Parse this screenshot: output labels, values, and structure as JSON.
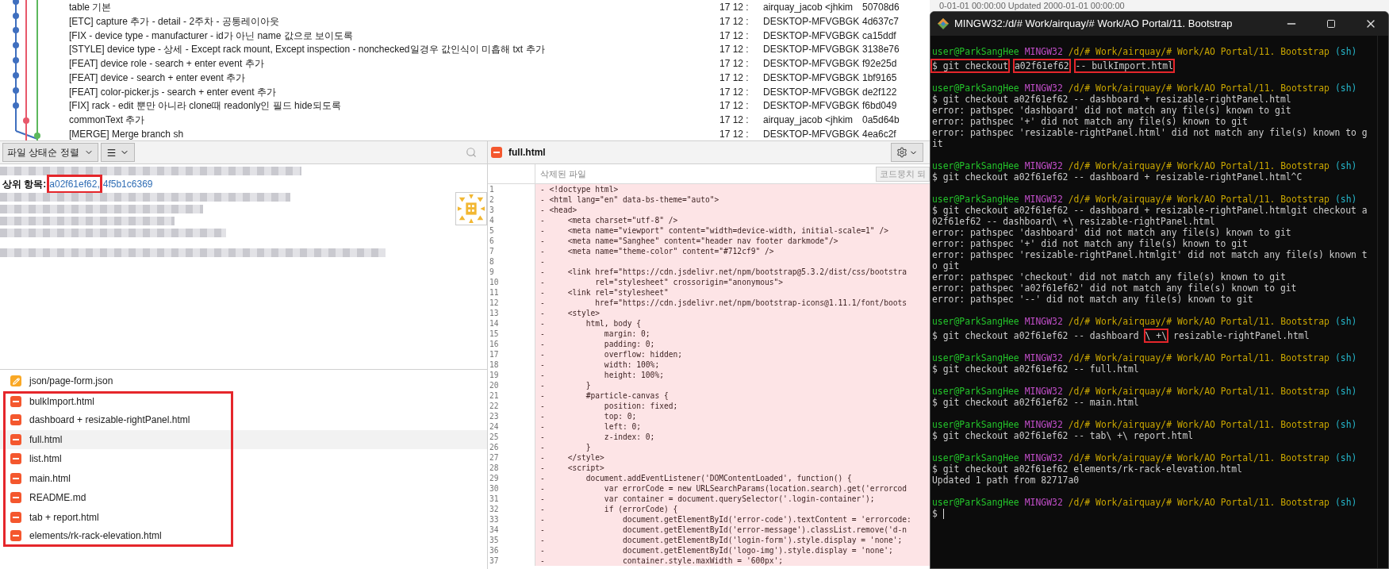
{
  "commits": [
    {
      "message": "table 기본",
      "date": "17 12 :",
      "author": "airquay_jacob <jhkim",
      "hash": "50708d6"
    },
    {
      "message": "[ETC] capture 추가 - detail - 2주차 - 공통레이아웃",
      "date": "17 12 :",
      "author": "DESKTOP-MFVGBGK",
      "hash": "4d637c7"
    },
    {
      "message": "[FIX - device type - manufacturer - id가 아닌 name 값으로 보이도록",
      "date": "17 12 :",
      "author": "DESKTOP-MFVGBGK",
      "hash": "ca15ddf"
    },
    {
      "message": "[STYLE] device type - 상세 - Except rack mount, Except inspection - nonchecked일경우 값인식이 미흡해 txt 추가",
      "date": "17 12 :",
      "author": "DESKTOP-MFVGBGK",
      "hash": "3138e76"
    },
    {
      "message": "[FEAT] device role - search + enter event 추가",
      "date": "17 12 :",
      "author": "DESKTOP-MFVGBGK",
      "hash": "f92e25d"
    },
    {
      "message": "[FEAT] device - search + enter event 추가",
      "date": "17 12 :",
      "author": "DESKTOP-MFVGBGK",
      "hash": "1bf9165"
    },
    {
      "message": "[FEAT] color-picker.js - search + enter event 추가",
      "date": "17 12 :",
      "author": "DESKTOP-MFVGBGK",
      "hash": "de2f122"
    },
    {
      "message": "[FIX] rack - edit 뿐만 아니라 clone때 readonly인 필드 hide되도록",
      "date": "17 12 :",
      "author": "DESKTOP-MFVGBGK",
      "hash": "f6bd049"
    },
    {
      "message": "commonText 추가",
      "date": "17 12 :",
      "author": "airquay_jacob <jhkim",
      "hash": "0a5d64b"
    },
    {
      "message": "[MERGE] Merge branch sh",
      "date": "17 12 :",
      "author": "DESKTOP-MFVGBGK",
      "hash": "4ea6c2f"
    }
  ],
  "toolbar": {
    "sort_label": "파일 상태순 정렬"
  },
  "details": {
    "parents_label": "상위 항목:",
    "parents": [
      {
        "text": "a02f61ef62,",
        "highlighted": true
      },
      {
        "text": "4f5b1c6369",
        "highlighted": false
      }
    ]
  },
  "files": [
    {
      "name": "json/page-form.json",
      "kind": "modified",
      "selected": false,
      "highlighted": false
    },
    {
      "name": "bulkImport.html",
      "kind": "removed",
      "selected": false,
      "highlighted": true
    },
    {
      "name": "dashboard + resizable-rightPanel.html",
      "kind": "removed",
      "selected": false,
      "highlighted": true
    },
    {
      "name": "full.html",
      "kind": "removed",
      "selected": true,
      "highlighted": true
    },
    {
      "name": "list.html",
      "kind": "removed",
      "selected": false,
      "highlighted": true
    },
    {
      "name": "main.html",
      "kind": "removed",
      "selected": false,
      "highlighted": true
    },
    {
      "name": "README.md",
      "kind": "removed",
      "selected": false,
      "highlighted": true
    },
    {
      "name": "tab + report.html",
      "kind": "removed",
      "selected": false,
      "highlighted": true
    },
    {
      "name": "elements/rk-rack-elevation.html",
      "kind": "removed",
      "selected": false,
      "highlighted": true
    }
  ],
  "diff": {
    "file": "full.html",
    "kind": "removed",
    "subtitle": "삭제된 파일",
    "hunk_button": "코드뭉치 되",
    "lines": [
      {
        "number": "1",
        "text": "- <!doctype html>"
      },
      {
        "number": "2",
        "text": "- <html lang=\"en\" data-bs-theme=\"auto\">"
      },
      {
        "number": "3",
        "text": "- <head>"
      },
      {
        "number": "4",
        "text": "-     <meta charset=\"utf-8\" />"
      },
      {
        "number": "5",
        "text": "-     <meta name=\"viewport\" content=\"width=device-width, initial-scale=1\" />"
      },
      {
        "number": "6",
        "text": "-     <meta name=\"Sanghee\" content=\"header nav footer darkmode\"/>"
      },
      {
        "number": "7",
        "text": "-     <meta name=\"theme-color\" content=\"#712cf9\" />"
      },
      {
        "number": "8",
        "text": "-"
      },
      {
        "number": "9",
        "text": "-     <link href=\"https://cdn.jsdelivr.net/npm/bootstrap@5.3.2/dist/css/bootstra"
      },
      {
        "number": "10",
        "text": "-           rel=\"stylesheet\" crossorigin=\"anonymous\">"
      },
      {
        "number": "11",
        "text": "-     <link rel=\"stylesheet\""
      },
      {
        "number": "12",
        "text": "-           href=\"https://cdn.jsdelivr.net/npm/bootstrap-icons@1.11.1/font/boots"
      },
      {
        "number": "13",
        "text": "-     <style>"
      },
      {
        "number": "14",
        "text": "-         html, body {"
      },
      {
        "number": "15",
        "text": "-             margin: 0;"
      },
      {
        "number": "16",
        "text": "-             padding: 0;"
      },
      {
        "number": "17",
        "text": "-             overflow: hidden;"
      },
      {
        "number": "18",
        "text": "-             width: 100%;"
      },
      {
        "number": "19",
        "text": "-             height: 100%;"
      },
      {
        "number": "20",
        "text": "-         }"
      },
      {
        "number": "21",
        "text": "-         #particle-canvas {"
      },
      {
        "number": "22",
        "text": "-             position: fixed;"
      },
      {
        "number": "23",
        "text": "-             top: 0;"
      },
      {
        "number": "24",
        "text": "-             left: 0;"
      },
      {
        "number": "25",
        "text": "-             z-index: 0;"
      },
      {
        "number": "26",
        "text": "-         }"
      },
      {
        "number": "27",
        "text": "-     </style>"
      },
      {
        "number": "28",
        "text": "-     <script>"
      },
      {
        "number": "29",
        "text": "-         document.addEventListener('DOMContentLoaded', function() {"
      },
      {
        "number": "30",
        "text": "-             var errorCode = new URLSearchParams(location.search).get('errorcod"
      },
      {
        "number": "31",
        "text": "-             var container = document.querySelector('.login-container');"
      },
      {
        "number": "32",
        "text": "-             if (errorCode) {"
      },
      {
        "number": "33",
        "text": "-                 document.getElementById('error-code').textContent = 'errorcode:"
      },
      {
        "number": "34",
        "text": "-                 document.getElementById('error-message').classList.remove('d-n"
      },
      {
        "number": "35",
        "text": "-                 document.getElementById('login-form').style.display = 'none';"
      },
      {
        "number": "36",
        "text": "-                 document.getElementById('logo-img').style.display = 'none';"
      },
      {
        "number": "37",
        "text": "-                 container.style.maxWidth = '600px';"
      }
    ]
  },
  "background_text": "0-01-01 00:00:00 Updated 2000-01-01 00:00:00",
  "terminal": {
    "title": "MINGW32:/d/# Work/airquay/# Work/AO Portal/11. Bootstrap",
    "blocks": [
      {
        "prompt": {
          "user": "user@ParkSangHee",
          "host": "MINGW32",
          "path": "/d/# Work/airquay/# Work/AO Portal/11. Bootstrap",
          "shell": "(sh)"
        },
        "lines": [
          {
            "kind": "command",
            "segments": [
              {
                "text": "$ git checkout",
                "highlighted": true
              },
              {
                "text": "a02f61ef62",
                "highlighted": true
              },
              {
                "text": "-- bulkImport.html",
                "highlighted": true
              }
            ]
          }
        ]
      },
      {
        "prompt": {
          "user": "user@ParkSangHee",
          "host": "MINGW32",
          "path": "/d/# Work/airquay/# Work/AO Portal/11. Bootstrap",
          "shell": "(sh)"
        },
        "lines": [
          {
            "kind": "command",
            "segments": [
              {
                "text": "$ git checkout a02f61ef62 -- dashboard + resizable-rightPanel.html",
                "highlighted": false
              }
            ]
          },
          {
            "kind": "output",
            "text": "error: pathspec 'dashboard' did not match any file(s) known to git"
          },
          {
            "kind": "output",
            "text": "error: pathspec '+' did not match any file(s) known to git"
          },
          {
            "kind": "output",
            "text": "error: pathspec 'resizable-rightPanel.html' did not match any file(s) known to g"
          },
          {
            "kind": "output",
            "text": "it"
          }
        ]
      },
      {
        "prompt": {
          "user": "user@ParkSangHee",
          "host": "MINGW32",
          "path": "/d/# Work/airquay/# Work/AO Portal/11. Bootstrap",
          "shell": "(sh)"
        },
        "lines": [
          {
            "kind": "command",
            "segments": [
              {
                "text": "$ git checkout a02f61ef62 -- dashboard + resizable-rightPanel.html^C",
                "highlighted": false
              }
            ]
          }
        ]
      },
      {
        "prompt": {
          "user": "user@ParkSangHee",
          "host": "MINGW32",
          "path": "/d/# Work/airquay/# Work/AO Portal/11. Bootstrap",
          "shell": "(sh)"
        },
        "lines": [
          {
            "kind": "command",
            "segments": [
              {
                "text": "$ git checkout a02f61ef62 -- dashboard + resizable-rightPanel.htmlgit checkout a",
                "highlighted": false
              }
            ]
          },
          {
            "kind": "command",
            "segments": [
              {
                "text": "02f61ef62 -- dashboard\\ +\\ resizable-rightPanel.html",
                "highlighted": false
              }
            ]
          },
          {
            "kind": "output",
            "text": "error: pathspec 'dashboard' did not match any file(s) known to git"
          },
          {
            "kind": "output",
            "text": "error: pathspec '+' did not match any file(s) known to git"
          },
          {
            "kind": "output",
            "text": "error: pathspec 'resizable-rightPanel.htmlgit' did not match any file(s) known t"
          },
          {
            "kind": "output",
            "text": "o git"
          },
          {
            "kind": "output",
            "text": "error: pathspec 'checkout' did not match any file(s) known to git"
          },
          {
            "kind": "output",
            "text": "error: pathspec 'a02f61ef62' did not match any file(s) known to git"
          },
          {
            "kind": "output",
            "text": "error: pathspec '--' did not match any file(s) known to git"
          }
        ]
      },
      {
        "prompt": {
          "user": "user@ParkSangHee",
          "host": "MINGW32",
          "path": "/d/# Work/airquay/# Work/AO Portal/11. Bootstrap",
          "shell": "(sh)"
        },
        "lines": [
          {
            "kind": "command",
            "segments": [
              {
                "text": "$ git checkout a02f61ef62 -- dashboard",
                "highlighted": false
              },
              {
                "text": "\\ +\\",
                "highlighted": true
              },
              {
                "text": "resizable-rightPanel.html",
                "highlighted": false
              }
            ]
          }
        ]
      },
      {
        "prompt": {
          "user": "user@ParkSangHee",
          "host": "MINGW32",
          "path": "/d/# Work/airquay/# Work/AO Portal/11. Bootstrap",
          "shell": "(sh)"
        },
        "lines": [
          {
            "kind": "command",
            "segments": [
              {
                "text": "$ git checkout a02f61ef62 -- full.html",
                "highlighted": false
              }
            ]
          }
        ]
      },
      {
        "prompt": {
          "user": "user@ParkSangHee",
          "host": "MINGW32",
          "path": "/d/# Work/airquay/# Work/AO Portal/11. Bootstrap",
          "shell": "(sh)"
        },
        "lines": [
          {
            "kind": "command",
            "segments": [
              {
                "text": "$ git checkout a02f61ef62 -- main.html",
                "highlighted": false
              }
            ]
          }
        ]
      },
      {
        "prompt": {
          "user": "user@ParkSangHee",
          "host": "MINGW32",
          "path": "/d/# Work/airquay/# Work/AO Portal/11. Bootstrap",
          "shell": "(sh)"
        },
        "lines": [
          {
            "kind": "command",
            "segments": [
              {
                "text": "$ git checkout a02f61ef62 -- tab\\ +\\ report.html",
                "highlighted": false
              }
            ]
          }
        ]
      },
      {
        "prompt": {
          "user": "user@ParkSangHee",
          "host": "MINGW32",
          "path": "/d/# Work/airquay/# Work/AO Portal/11. Bootstrap",
          "shell": "(sh)"
        },
        "lines": [
          {
            "kind": "command",
            "segments": [
              {
                "text": "$ git checkout a02f61ef62 elements/rk-rack-elevation.html",
                "highlighted": false
              }
            ]
          },
          {
            "kind": "output",
            "text": "Updated 1 path from 82717a0"
          }
        ]
      },
      {
        "prompt": {
          "user": "user@ParkSangHee",
          "host": "MINGW32",
          "path": "/d/# Work/airquay/# Work/AO Portal/11. Bootstrap",
          "shell": "(sh)"
        },
        "lines": [
          {
            "kind": "input",
            "text": "$"
          }
        ]
      }
    ]
  }
}
